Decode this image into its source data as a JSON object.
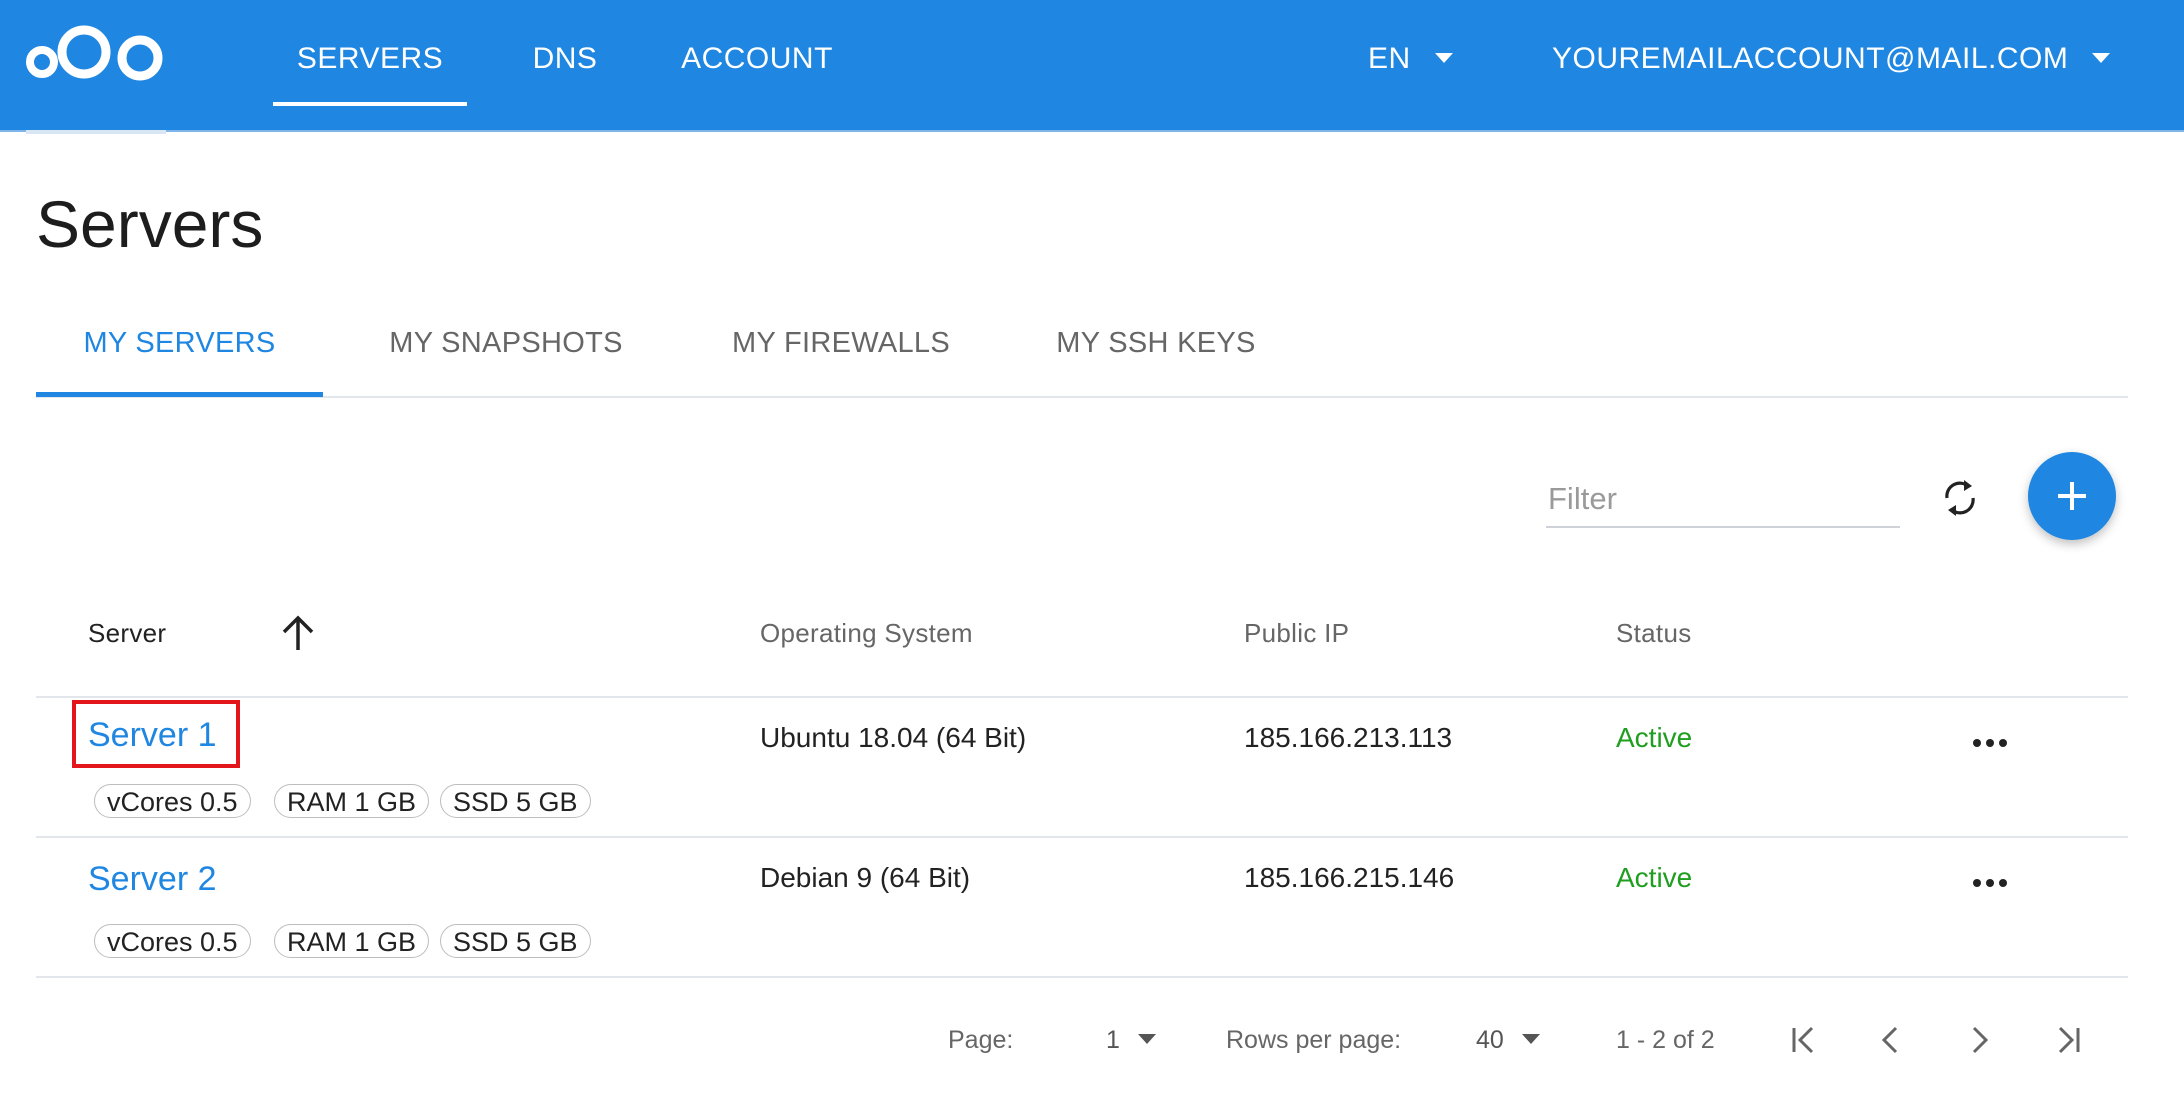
{
  "colors": {
    "brand": "#1f86e2",
    "status_active": "#1f9e1f",
    "highlight": "#e3161c"
  },
  "nav": {
    "logo_icon": "nextcloud-logo-icon",
    "items": [
      {
        "label": "SERVERS",
        "active": true
      },
      {
        "label": "DNS"
      },
      {
        "label": "ACCOUNT"
      }
    ],
    "language": "EN",
    "user": "YOUREMAILACCOUNT@MAIL.COM"
  },
  "page": {
    "title": "Servers"
  },
  "tabs": [
    {
      "label": "MY SERVERS",
      "active": true
    },
    {
      "label": "MY SNAPSHOTS"
    },
    {
      "label": "MY FIREWALLS"
    },
    {
      "label": "MY SSH KEYS"
    }
  ],
  "toolbar": {
    "filter_placeholder": "Filter",
    "refresh_icon": "refresh-icon",
    "add_icon": "plus-icon"
  },
  "table": {
    "columns": [
      "Server",
      "Operating System",
      "Public IP",
      "Status"
    ],
    "sort_icon": "arrow-up-icon",
    "rows": [
      {
        "name": "Server 1",
        "specs": [
          "vCores 0.5",
          "RAM 1 GB",
          "SSD 5 GB"
        ],
        "os": "Ubuntu 18.04 (64 Bit)",
        "ip": "185.166.213.113",
        "status": "Active"
      },
      {
        "name": "Server 2",
        "specs": [
          "vCores 0.5",
          "RAM 1 GB",
          "SSD 5 GB"
        ],
        "os": "Debian 9 (64 Bit)",
        "ip": "185.166.215.146",
        "status": "Active"
      }
    ]
  },
  "pagination": {
    "page_label": "Page:",
    "page_value": "1",
    "rows_label": "Rows per page:",
    "rows_value": "40",
    "range": "1 - 2 of 2"
  }
}
